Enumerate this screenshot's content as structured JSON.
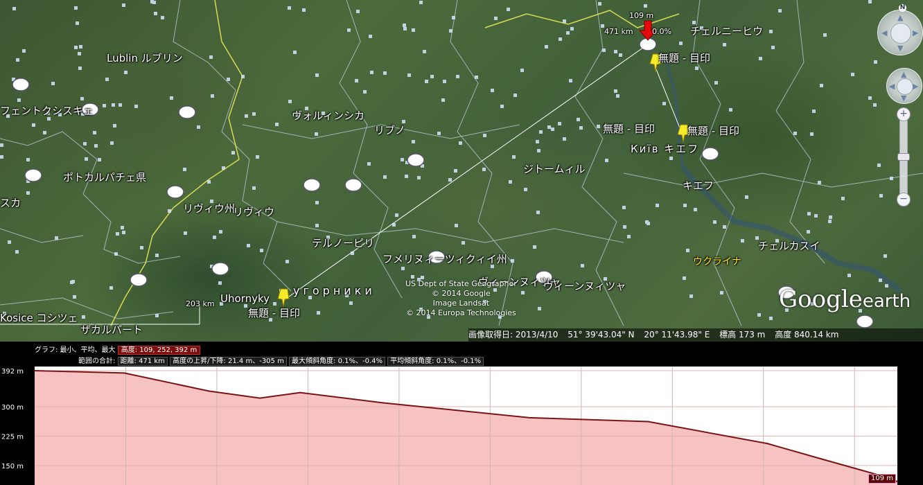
{
  "map": {
    "labels": [
      {
        "text": "Lublin ルブリン",
        "cls": ""
      },
      {
        "text": "フェントクシスキェ",
        "cls": ""
      },
      {
        "text": "ヴォルィンシカ",
        "cls": ""
      },
      {
        "text": "リブノ",
        "cls": ""
      },
      {
        "text": "ポトカルパチェ県",
        "cls": ""
      },
      {
        "text": "スカ",
        "cls": ""
      },
      {
        "text": "リヴィウ州",
        "cls": ""
      },
      {
        "text": "リヴィウ",
        "cls": ""
      },
      {
        "text": "テルノーピリ",
        "cls": ""
      },
      {
        "text": "フメリヌィーツィクィイ州",
        "cls": ""
      },
      {
        "text": "ヴィーンヌィツャ",
        "cls": ""
      },
      {
        "text": "ヴィーンヌィツャ",
        "cls": ""
      },
      {
        "text": "ジトームィル",
        "cls": ""
      },
      {
        "text": "チェルニーヒウ",
        "cls": ""
      },
      {
        "text": "Київ キエフ",
        "cls": ""
      },
      {
        "text": "キエフ",
        "cls": ""
      },
      {
        "text": "チェルカスイ",
        "cls": ""
      },
      {
        "text": "ウクライナ",
        "cls": "yellow"
      },
      {
        "text": "Uhornyky",
        "cls": ""
      },
      {
        "text": "угорники",
        "cls": "spaced"
      },
      {
        "text": "Kosice コシツェ",
        "cls": ""
      },
      {
        "text": "ザカルパート",
        "cls": ""
      },
      {
        "text": "203 km",
        "cls": "small"
      }
    ],
    "placemarks": [
      {
        "name": "無題 - 目印"
      },
      {
        "name": "無題 - 目印"
      },
      {
        "name": "無題 - 目印"
      },
      {
        "name": "無題 - 目印"
      }
    ],
    "path_marker": {
      "elevation": "109 m",
      "distance": "471 km",
      "slope": "0.0%"
    },
    "credits": [
      "US Dept of State Geographer",
      "© 2014 Google",
      "Image Landsat",
      "© 2014 Europa Technologies"
    ],
    "logo": {
      "main": "Google",
      "sub": "earth"
    },
    "compass_north": "N",
    "zoom_plus": "+",
    "zoom_minus": "−"
  },
  "status_bar": {
    "imagery_date": "画像取得日: 2013/4/10",
    "latitude": "51° 39'43.04\" N",
    "longitude": "20° 11'43.98\" E",
    "elevation": "標高  173 m",
    "eye_alt": "高度  840.14 km"
  },
  "elevation_profile": {
    "graph_label": "グラフ: 最小、平均、最大",
    "elevation_label": "高度: 109, 252, 392 m",
    "range_label": "範囲の合計:",
    "distance_label": "距離: 471 km",
    "gain_loss_label": "高度の上昇/下降: 21.4 m、-305 m",
    "max_slope_label": "最大傾斜角度: 0.1%、-0.4%",
    "avg_slope_label": "平均傾斜角度: 0.1%、-0.1%",
    "end_marker": "109 m",
    "y_ticks": [
      "392 m",
      "300 m",
      "225 m",
      "150 m"
    ]
  },
  "chart_data": {
    "type": "area",
    "title": "",
    "xlabel": "",
    "ylabel": "",
    "x_unit": "km",
    "x": [
      0,
      49,
      95,
      123,
      145,
      190,
      270,
      335,
      400,
      430,
      462,
      471
    ],
    "y": [
      392,
      386,
      340,
      322,
      336,
      310,
      272,
      262,
      206,
      166,
      124,
      109
    ],
    "xlim": [
      0,
      471
    ],
    "ylim": [
      109,
      392
    ],
    "yticks": [
      392,
      300,
      225,
      150
    ],
    "series_color": "#7a1414",
    "fill_color": "#f6c2c2",
    "grid": true
  }
}
